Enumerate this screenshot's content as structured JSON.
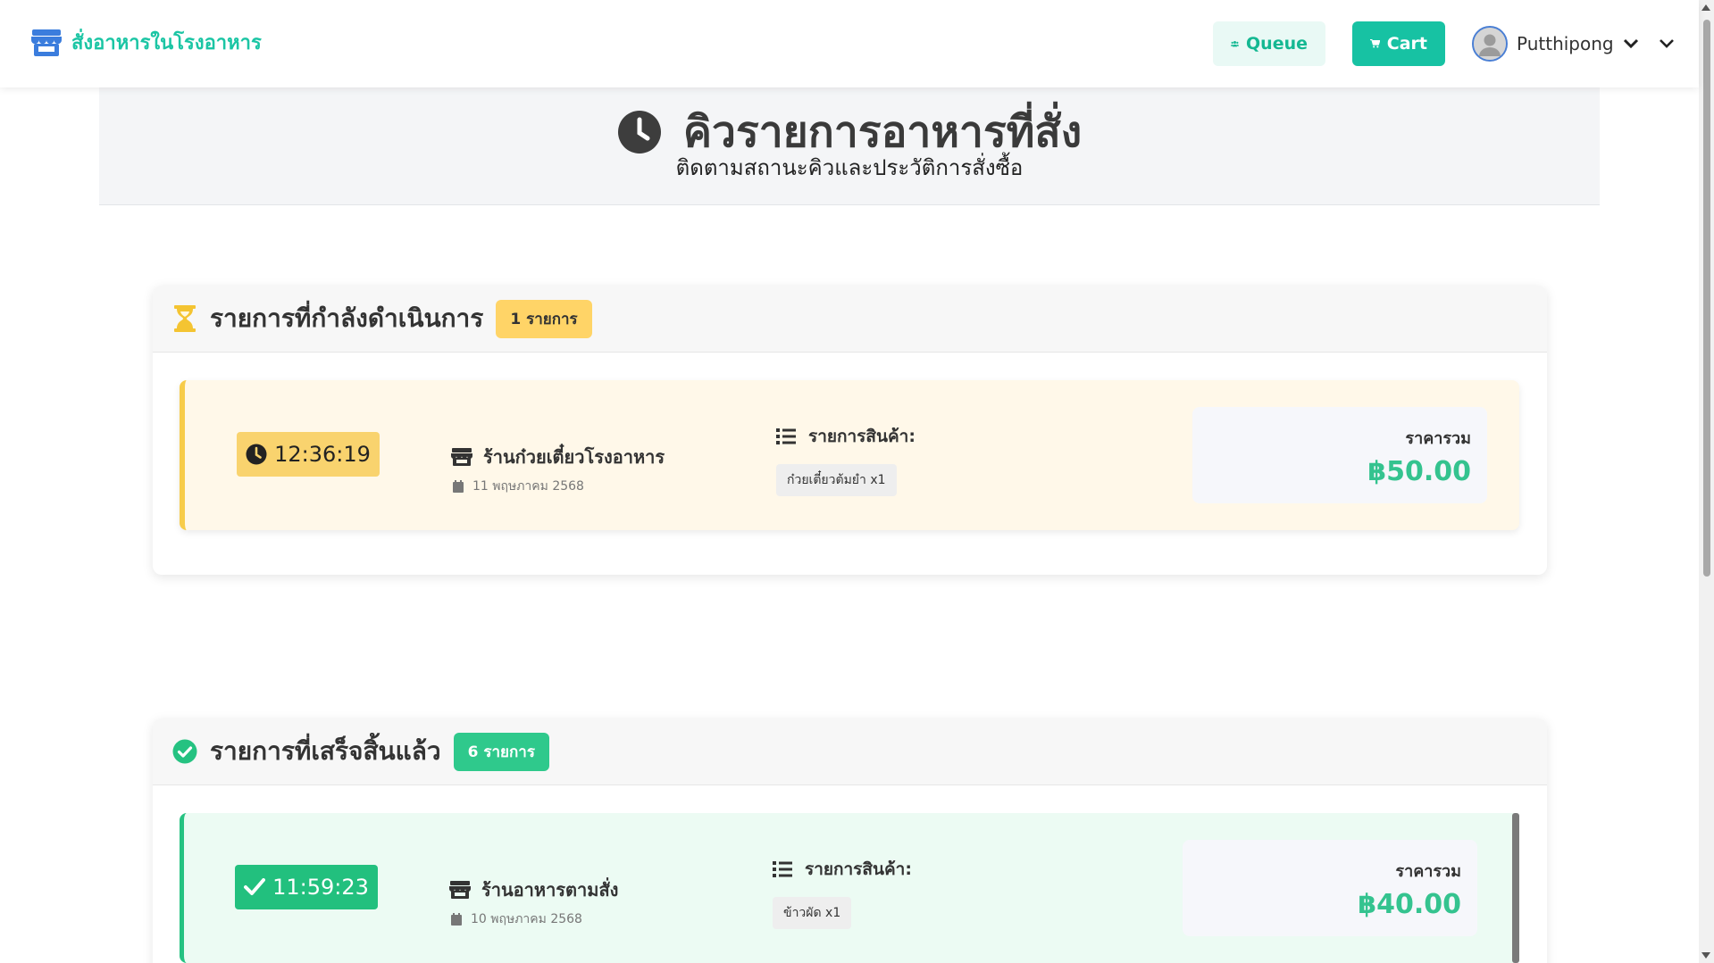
{
  "navbar": {
    "brand": "สั่งอาหารในโรงอาหาร",
    "queue_label": "Queue",
    "cart_label": "Cart",
    "username": "Putthipong",
    "brand_color": "#1bc5a4"
  },
  "hero": {
    "title": "คิวรายการอาหารที่สั่ง",
    "subtitle": "ติดตามสถานะคิวและประวัติการสั่งซื้อ"
  },
  "pending": {
    "heading": "รายการที่กำลังดำเนินการ",
    "count_badge": "1 รายการ",
    "orders": [
      {
        "time": "12:36:19",
        "shop": "ร้านก๋วยเตี๋ยวโรงอาหาร",
        "date": "11 พฤษภาคม 2568",
        "items_label": "รายการสินค้า:",
        "items": [
          "ก๋วยเตี๋ยวต้มยำ x1"
        ],
        "total_label": "ราคารวม",
        "total": "฿50.00"
      }
    ]
  },
  "completed": {
    "heading": "รายการที่เสร็จสิ้นแล้ว",
    "count_badge": "6 รายการ",
    "orders": [
      {
        "time": "11:59:23",
        "shop": "ร้านอาหารตามสั่ง",
        "date": "10 พฤษภาคม 2568",
        "items_label": "รายการสินค้า:",
        "items": [
          "ข้าวผัด x1"
        ],
        "total_label": "ราคารวม",
        "total": "฿40.00"
      }
    ]
  },
  "icons": {
    "brand": "store-icon",
    "queue": "users-icon",
    "cart": "cart-icon",
    "pending": "hourglass-icon",
    "completed": "check-circle-icon"
  }
}
